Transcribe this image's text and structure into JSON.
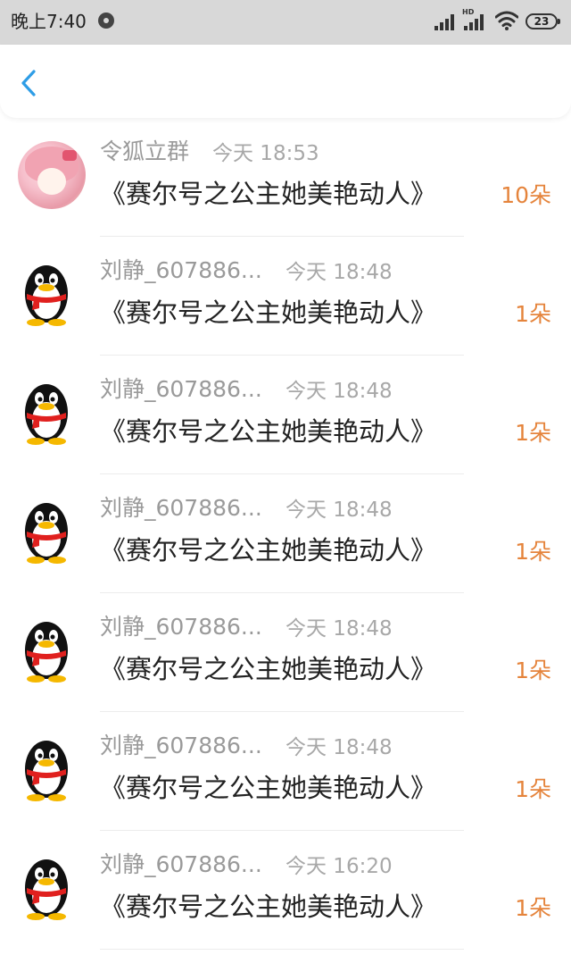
{
  "status_bar": {
    "time": "晚上7:40",
    "hd_label": "HD",
    "battery": "23"
  },
  "nav": {
    "back_icon": "chevron-left-icon",
    "accent": "#2e9de6"
  },
  "list": {
    "items": [
      {
        "name": "令狐立群",
        "time": "今天 18:53",
        "title": "《赛尔号之公主她美艳动人》",
        "count": "10朵",
        "avatar": "anime"
      },
      {
        "name": "刘静_607886...",
        "time": "今天 18:48",
        "title": "《赛尔号之公主她美艳动人》",
        "count": "1朵",
        "avatar": "penguin"
      },
      {
        "name": "刘静_607886...",
        "time": "今天 18:48",
        "title": "《赛尔号之公主她美艳动人》",
        "count": "1朵",
        "avatar": "penguin"
      },
      {
        "name": "刘静_607886...",
        "time": "今天 18:48",
        "title": "《赛尔号之公主她美艳动人》",
        "count": "1朵",
        "avatar": "penguin"
      },
      {
        "name": "刘静_607886...",
        "time": "今天 18:48",
        "title": "《赛尔号之公主她美艳动人》",
        "count": "1朵",
        "avatar": "penguin"
      },
      {
        "name": "刘静_607886...",
        "time": "今天 18:48",
        "title": "《赛尔号之公主她美艳动人》",
        "count": "1朵",
        "avatar": "penguin"
      },
      {
        "name": "刘静_607886...",
        "time": "今天 16:20",
        "title": "《赛尔号之公主她美艳动人》",
        "count": "1朵",
        "avatar": "penguin"
      }
    ]
  },
  "colors": {
    "count": "#e5843c",
    "name": "#9a9a9a",
    "title": "#222222",
    "status_bar_bg": "#d8d8d8"
  }
}
